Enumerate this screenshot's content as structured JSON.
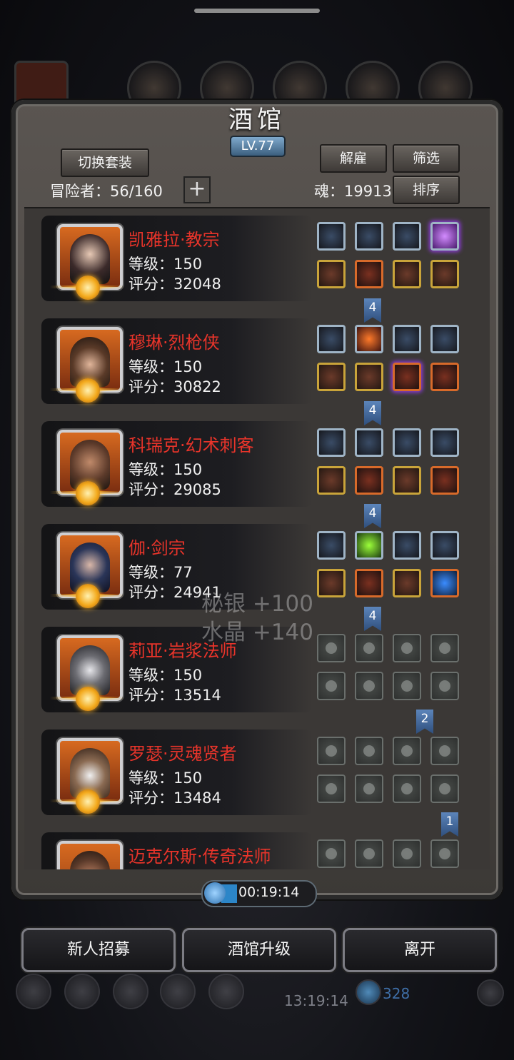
{
  "title": "酒馆",
  "level_badge": "LV.77",
  "buttons": {
    "switch_set": "切换套装",
    "dismiss": "解雇",
    "filter": "筛选",
    "sort": "排序",
    "add": "+"
  },
  "stats": {
    "adventurers": "冒险者：56/160",
    "souls": "魂：19913"
  },
  "heroes": [
    {
      "name": "凯雅拉·教宗",
      "level": "等级：150",
      "score": "评分：32048",
      "ribbon": "4"
    },
    {
      "name": "穆琳·烈枪侠",
      "level": "等级：150",
      "score": "评分：30822",
      "ribbon": "4"
    },
    {
      "name": "科瑞克·幻术刺客",
      "level": "等级：150",
      "score": "评分：29085",
      "ribbon": "4"
    },
    {
      "name": "伽·剑宗",
      "level": "等级：77",
      "score": "评分：24941",
      "ribbon": "4"
    },
    {
      "name": "莉亚·岩浆法师",
      "level": "等级：150",
      "score": "评分：13514",
      "ribbon": "2"
    },
    {
      "name": "罗瑟·灵魂贤者",
      "level": "等级：150",
      "score": "评分：13484",
      "ribbon": "1"
    },
    {
      "name": "迈克尔斯·传奇法师",
      "level": "",
      "score": "",
      "ribbon": ""
    }
  ],
  "floating_rewards": [
    "秘银 +100",
    "水晶 +140"
  ],
  "timer": "00:19:14",
  "bottom_buttons": {
    "recruit": "新人招募",
    "upgrade": "酒馆升级",
    "leave": "离开"
  },
  "dock": {
    "time": "13:19:14",
    "gems": "328"
  },
  "colors": {
    "hero_name": "#e8342a",
    "level_badge": "#5b86ad",
    "ribbon": "#3f6497"
  }
}
